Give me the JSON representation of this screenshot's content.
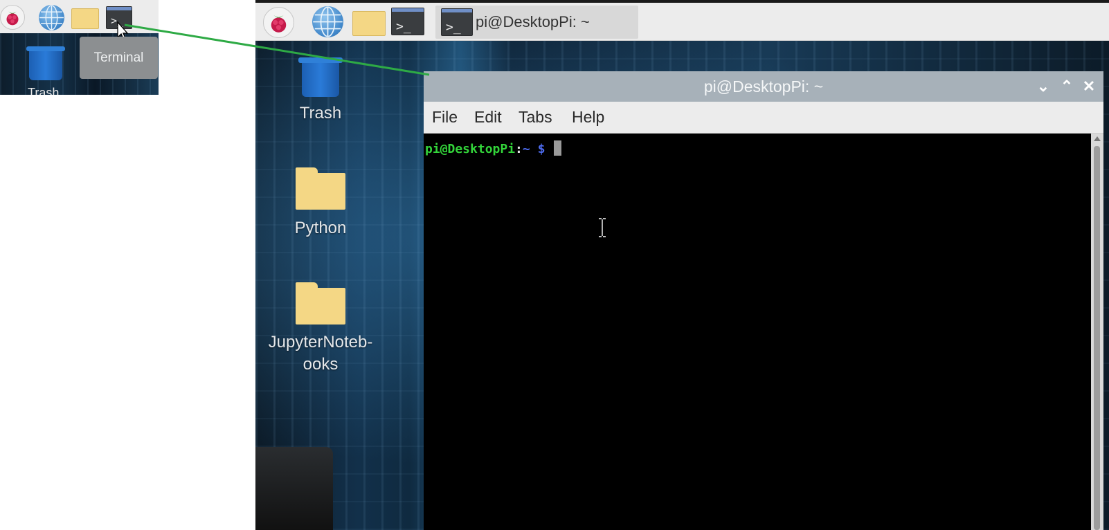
{
  "inset": {
    "tooltip": "Terminal",
    "trash_label": "Trash"
  },
  "panel": {
    "launchers": [
      "raspberry-menu",
      "web-browser",
      "file-manager",
      "terminal"
    ],
    "task_button": {
      "label": "pi@DesktopPi: ~"
    }
  },
  "desktop": {
    "icons": [
      {
        "label": "Trash"
      },
      {
        "label": "Python"
      },
      {
        "label_line1": "JupyterNoteb-",
        "label_line2": "ooks"
      }
    ]
  },
  "terminal_window": {
    "title": "pi@DesktopPi: ~",
    "controls": {
      "minimize": "⌄",
      "maximize": "⌃",
      "close": "✕"
    },
    "menu": [
      "File",
      "Edit",
      "Tabs",
      "Help"
    ],
    "prompt": {
      "user_host": "pi@DesktopPi",
      "colon": ":",
      "path": "~",
      "symbol": " $ "
    }
  },
  "colors": {
    "annotation_line": "#2eaa45",
    "prompt_user": "#33d43a",
    "prompt_path": "#4e6cf0",
    "titlebar": "#a7b1b9"
  }
}
